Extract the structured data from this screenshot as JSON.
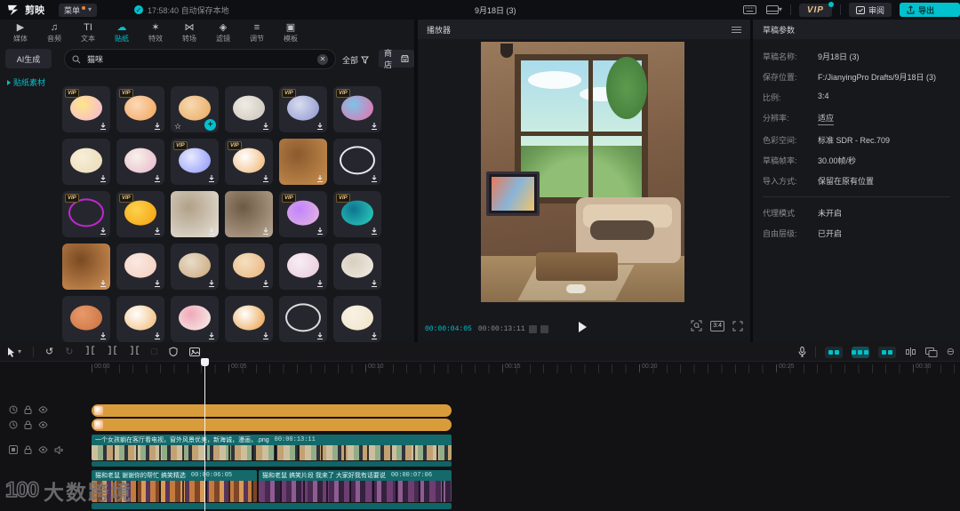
{
  "colors": {
    "accent": "#00c1cd",
    "vip_gold": "#e8c48a",
    "track_orange": "#d99c3b",
    "clip_teal": "#14696b"
  },
  "titlebar": {
    "app_name": "剪映",
    "menu_label": "菜单",
    "autosave_text": "17:58:40 自动保存本地",
    "doc_title": "9月18日 (3)",
    "vip_label": "VIP",
    "review_label": "审阅",
    "export_label": "导出"
  },
  "toolbar": {
    "items": [
      {
        "label": "媒体",
        "icon": "media",
        "active": false
      },
      {
        "label": "音频",
        "icon": "audio",
        "active": false
      },
      {
        "label": "文本",
        "icon": "text",
        "active": false
      },
      {
        "label": "贴纸",
        "icon": "sticker",
        "active": true
      },
      {
        "label": "特效",
        "icon": "effects",
        "active": false
      },
      {
        "label": "转场",
        "icon": "transition",
        "active": false
      },
      {
        "label": "滤镜",
        "icon": "filter",
        "active": false
      },
      {
        "label": "调节",
        "icon": "adjust",
        "active": false
      },
      {
        "label": "模板",
        "icon": "template",
        "active": false
      }
    ]
  },
  "sticker_panel": {
    "ai_generate": "AI生成",
    "nav_sticker": "贴纸素材",
    "search_value": "猫咪",
    "filter_all": "全部",
    "shop": "商店",
    "vip_badge": "VIP",
    "stickers": [
      {
        "vip": true,
        "c1": "#f8b4d9",
        "c2": "#fde68a"
      },
      {
        "vip": true,
        "c1": "#f2a154",
        "c2": "#fcd9b8"
      },
      {
        "vip": false,
        "selected": true,
        "c1": "#e8a75c",
        "c2": "#f7d9b0"
      },
      {
        "vip": false,
        "c1": "#c9c2b8",
        "c2": "#f0ece4"
      },
      {
        "vip": true,
        "c1": "#8b93cc",
        "c2": "#d8dcf0"
      },
      {
        "vip": true,
        "c1": "#f06ba8",
        "c2": "#7cc4e8"
      },
      {
        "vip": false,
        "c1": "#ead9b4",
        "c2": "#f7efd9"
      },
      {
        "vip": false,
        "c1": "#e8b4c8",
        "c2": "#f7f2ea"
      },
      {
        "vip": true,
        "c1": "#8a93f8",
        "c2": "#e8eaff"
      },
      {
        "vip": true,
        "c1": "#f0b06a",
        "c2": "#ffffff"
      },
      {
        "vip": false,
        "photo": true,
        "c1": "#c98f4e",
        "c2": "#8a5a2e"
      },
      {
        "vip": false,
        "outline": true,
        "c1": "#e8e8ee",
        "c2": "#2a2b33"
      },
      {
        "vip": true,
        "outline": true,
        "c1": "#c026d3",
        "c2": "#22d3ee"
      },
      {
        "vip": true,
        "c1": "#f59e0b",
        "c2": "#fcd34d"
      },
      {
        "vip": false,
        "photo": true,
        "c1": "#e8e2d8",
        "c2": "#b0a088"
      },
      {
        "vip": false,
        "photo": true,
        "c1": "#b9a893",
        "c2": "#6e5a44"
      },
      {
        "vip": true,
        "c1": "#e9b7dd",
        "c2": "#c084fc"
      },
      {
        "vip": true,
        "c1": "#2dd4bf",
        "c2": "#0e7490"
      },
      {
        "vip": false,
        "photo": true,
        "c1": "#d29257",
        "c2": "#7a4a22"
      },
      {
        "vip": false,
        "c1": "#f3cdbf",
        "c2": "#fae8e0"
      },
      {
        "vip": false,
        "c1": "#caa77a",
        "c2": "#e8dcc8"
      },
      {
        "vip": false,
        "c1": "#e8b27a",
        "c2": "#f5e0c0"
      },
      {
        "vip": false,
        "c1": "#e7c8d8",
        "c2": "#f8eef4"
      },
      {
        "vip": false,
        "c1": "#f2ece2",
        "c2": "#d8cfc0"
      },
      {
        "vip": false,
        "c1": "#c96f3f",
        "c2": "#e89a6a"
      },
      {
        "vip": false,
        "c1": "#f0b46a",
        "c2": "#ffffff"
      },
      {
        "vip": false,
        "c1": "#f7f3ec",
        "c2": "#f0a8b8"
      },
      {
        "vip": false,
        "c1": "#e89a3c",
        "c2": "#ffffff"
      },
      {
        "vip": false,
        "outline": true,
        "c1": "#dcdcdc",
        "c2": "#8a8a8a"
      },
      {
        "vip": false,
        "c1": "#efe3c8",
        "c2": "#f8f2e4"
      }
    ]
  },
  "player": {
    "title": "播放器",
    "current_time": "00:00:04:05",
    "total_time": "00:00:13:11",
    "ratio": "3:4"
  },
  "draft_params": {
    "title": "草稿参数",
    "rows": [
      {
        "label": "草稿名称:",
        "value": "9月18日 (3)"
      },
      {
        "label": "保存位置:",
        "value": "F:/JianyingPro Drafts/9月18日 (3)"
      },
      {
        "label": "比例:",
        "value": "3:4"
      },
      {
        "label": "分辨率:",
        "value": "适应",
        "link": true
      },
      {
        "label": "色彩空间:",
        "value": "标准 SDR - Rec.709"
      },
      {
        "label": "草稿帧率:",
        "value": "30.00帧/秒"
      },
      {
        "label": "导入方式:",
        "value": "保留在原有位置"
      }
    ],
    "rows2": [
      {
        "label": "代理模式",
        "value": "未开启"
      },
      {
        "label": "自由层级:",
        "value": "已开启"
      }
    ]
  },
  "timeline": {
    "ruler_labels": [
      "00:00",
      "00:05",
      "00:10",
      "00:15",
      "00:20",
      "00:25",
      "00:30"
    ],
    "main_clip": {
      "label": "一个女孩躺在客厅看电视，窗外风景优美，新海诚，漫画，.png",
      "duration": "00:00:13:11"
    },
    "clips": [
      {
        "label": "猫和老鼠 谢谢你的帮忙 搞笑精选",
        "duration": "00:00:06:05"
      },
      {
        "label": "猫和老鼠 搞笑片段 我来了 大家好我有话要说",
        "duration": "00:00:07:06"
      }
    ]
  },
  "watermark": {
    "logo": "100",
    "text": "大数跨境"
  }
}
